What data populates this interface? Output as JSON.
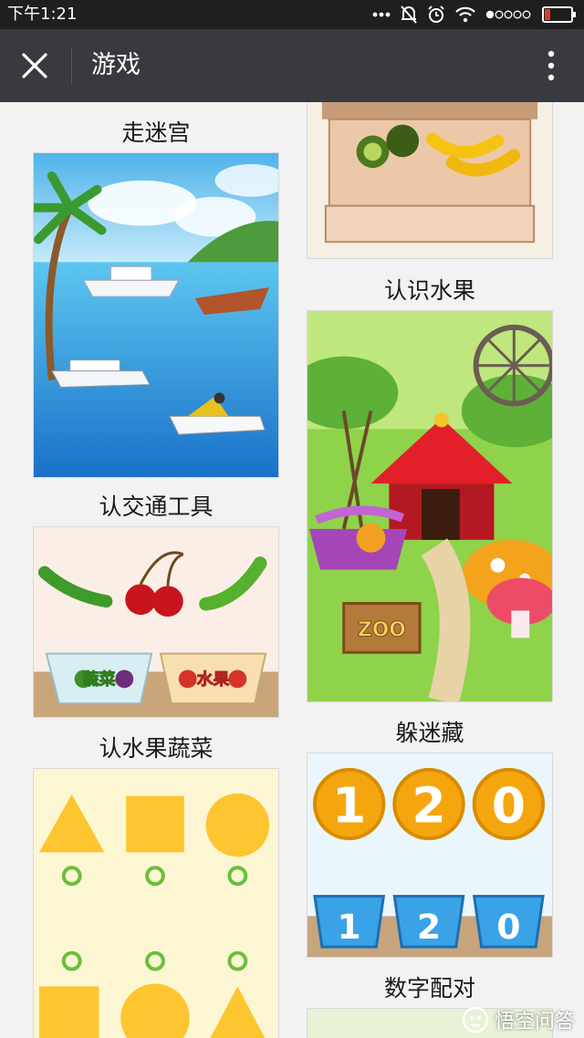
{
  "status": {
    "time": "下午1:21",
    "icons": [
      "more-dots-icon",
      "mute-bell-icon",
      "alarm-icon",
      "wifi-icon",
      "signal-icon",
      "battery-low-icon"
    ]
  },
  "nav": {
    "title": "游戏",
    "close_icon": "close-icon",
    "menu_icon": "more-vertical-icon"
  },
  "games": {
    "maze": {
      "label": "走迷宫"
    },
    "transport": {
      "label": "认交通工具"
    },
    "fruit_veg": {
      "label": "认水果蔬菜",
      "bowl_left": "蔬菜",
      "bowl_right": "水果"
    },
    "fruits": {
      "label": "认识水果"
    },
    "hide_seek": {
      "label": "躲迷藏",
      "sign": "ZOO"
    },
    "numbers": {
      "label": "数字配对",
      "coins": [
        "1",
        "2",
        "0"
      ],
      "cups": [
        "1",
        "2",
        "0"
      ]
    }
  },
  "watermark": {
    "text": "悟空问答"
  },
  "colors": {
    "status_bg": "#1f1f1f",
    "nav_bg": "#393a3f",
    "content_bg": "#f2f2f2",
    "shape_yellow": "#fdc52f",
    "circle_green": "#6abf3b"
  }
}
